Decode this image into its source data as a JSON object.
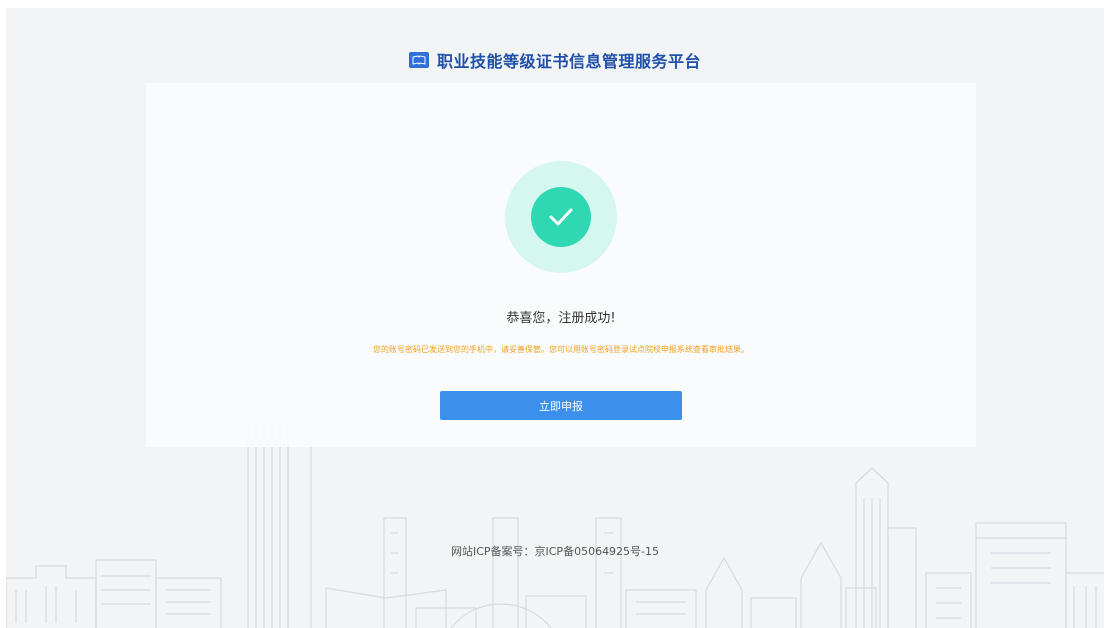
{
  "header": {
    "logo_icon": "book-logo-icon",
    "title": "职业技能等级证书信息管理服务平台"
  },
  "status": {
    "icon": "check-circle-icon",
    "headline": "恭喜您，注册成功!",
    "notice": "您的账号密码已发送到您的手机中，请妥善保管。您可以用账号密码登录试点院校申报系统查看审批结果。"
  },
  "actions": {
    "apply_now": "立即申报"
  },
  "footer": {
    "icp": "网站ICP备案号：京ICP备05064925号-15"
  },
  "colors": {
    "brand": "#1f4fa8",
    "button": "#3a90ea",
    "success": "#2fd8b3",
    "success_halo": "#d5f7f0",
    "notice": "#f0a020"
  }
}
